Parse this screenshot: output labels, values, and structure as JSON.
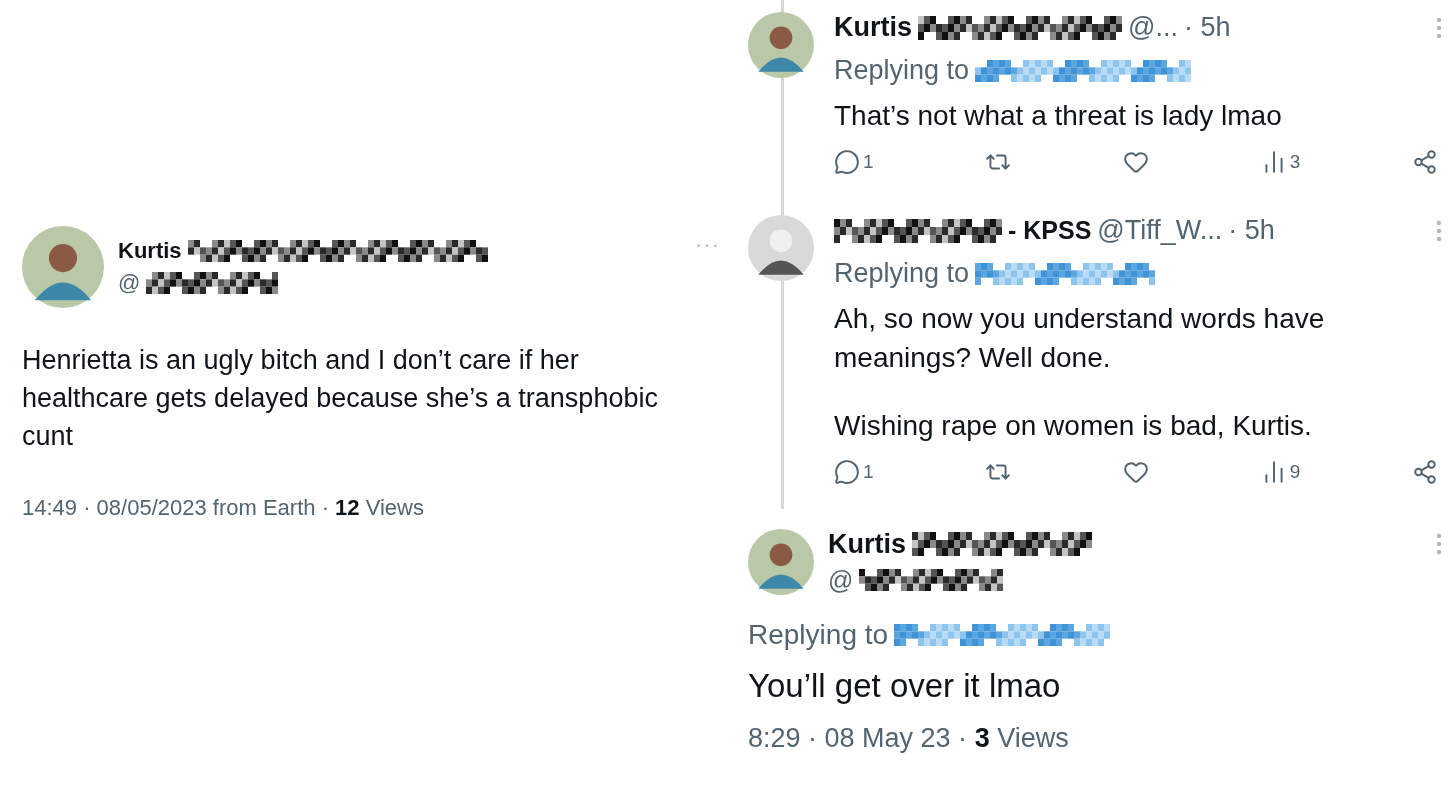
{
  "main_tweet": {
    "name": "Kurtis",
    "handle": "@",
    "text": "Henrietta is an ugly bitch and I don’t care if her healthcare gets delayed because she’s a transphobic cunt",
    "time": "14:49 · 08/05/2023 from Earth ·",
    "views_count": "12",
    "views_label": "Views",
    "more": "···"
  },
  "replies": [
    {
      "kind": "bearded",
      "name": "Kurtis",
      "handle": "@...",
      "age": "· 5h",
      "replying_to": "Replying to",
      "paragraphs": [
        "That’s not what a threat is lady lmao"
      ],
      "actions": [
        {
          "kind": "reply",
          "count": "1"
        },
        {
          "kind": "retweet"
        },
        {
          "kind": "like"
        },
        {
          "kind": "views",
          "count": "3"
        },
        {
          "kind": "share"
        }
      ]
    },
    {
      "kind": "monochrome",
      "name": "- KPSS",
      "handle": "@Tiff_W...",
      "age": "· 5h",
      "replying_to": "Replying to",
      "paragraphs": [
        "Ah, so now you understand words have meanings? Well done.",
        "Wishing rape on women is bad, Kurtis."
      ],
      "actions": [
        {
          "kind": "reply",
          "count": "1"
        },
        {
          "kind": "retweet"
        },
        {
          "kind": "like"
        },
        {
          "kind": "views",
          "count": "9"
        },
        {
          "kind": "share"
        }
      ]
    }
  ],
  "focused_reply": {
    "name": "Kurtis",
    "handle": "@",
    "replying_to": "Replying to",
    "text": "You’ll get over it lmao",
    "time": "8:29 · 08 May 23 ·",
    "views_count": "3",
    "views_label": "Views"
  }
}
